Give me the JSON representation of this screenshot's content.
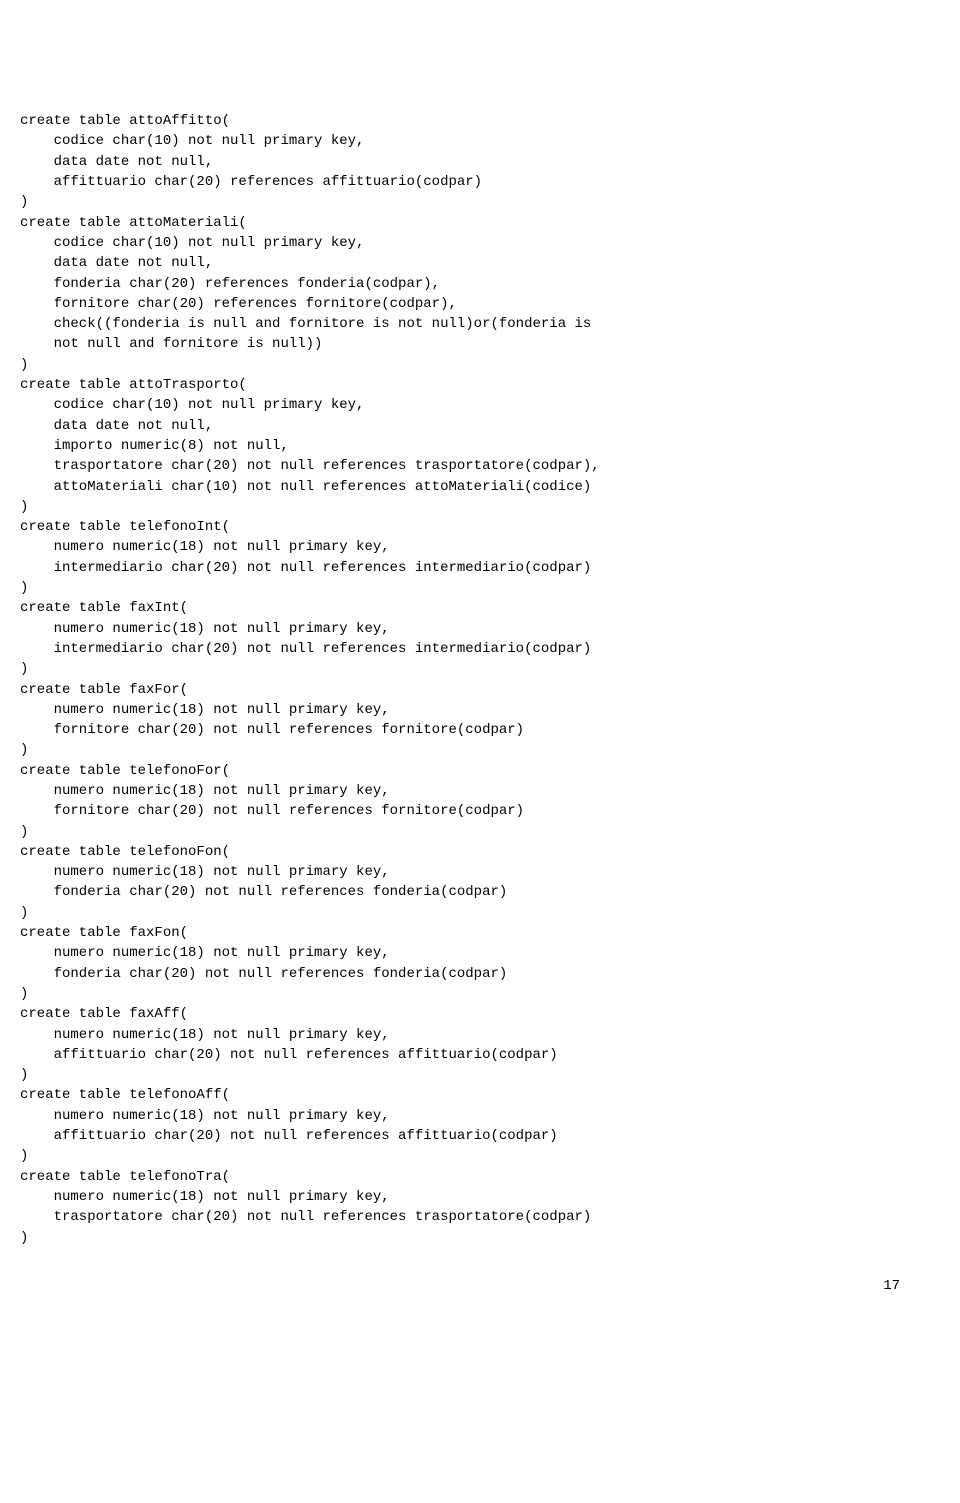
{
  "code": "create table attoAffitto(\n    codice char(10) not null primary key,\n    data date not null,\n    affittuario char(20) references affittuario(codpar)\n)\ncreate table attoMateriali(\n    codice char(10) not null primary key,\n    data date not null,\n    fonderia char(20) references fonderia(codpar),\n    fornitore char(20) references fornitore(codpar),\n    check((fonderia is null and fornitore is not null)or(fonderia is\n    not null and fornitore is null))\n)\ncreate table attoTrasporto(\n    codice char(10) not null primary key,\n    data date not null,\n    importo numeric(8) not null,\n    trasportatore char(20) not null references trasportatore(codpar),\n    attoMateriali char(10) not null references attoMateriali(codice)\n)\ncreate table telefonoInt(\n    numero numeric(18) not null primary key,\n    intermediario char(20) not null references intermediario(codpar)\n)\ncreate table faxInt(\n    numero numeric(18) not null primary key,\n    intermediario char(20) not null references intermediario(codpar)\n)\ncreate table faxFor(\n    numero numeric(18) not null primary key,\n    fornitore char(20) not null references fornitore(codpar)\n)\ncreate table telefonoFor(\n    numero numeric(18) not null primary key,\n    fornitore char(20) not null references fornitore(codpar)\n)\ncreate table telefonoFon(\n    numero numeric(18) not null primary key,\n    fonderia char(20) not null references fonderia(codpar)\n)\ncreate table faxFon(\n    numero numeric(18) not null primary key,\n    fonderia char(20) not null references fonderia(codpar)\n)\ncreate table faxAff(\n    numero numeric(18) not null primary key,\n    affittuario char(20) not null references affittuario(codpar)\n)\ncreate table telefonoAff(\n    numero numeric(18) not null primary key,\n    affittuario char(20) not null references affittuario(codpar)\n)\ncreate table telefonoTra(\n    numero numeric(18) not null primary key,\n    trasportatore char(20) not null references trasportatore(codpar)\n)",
  "page_number": "17"
}
